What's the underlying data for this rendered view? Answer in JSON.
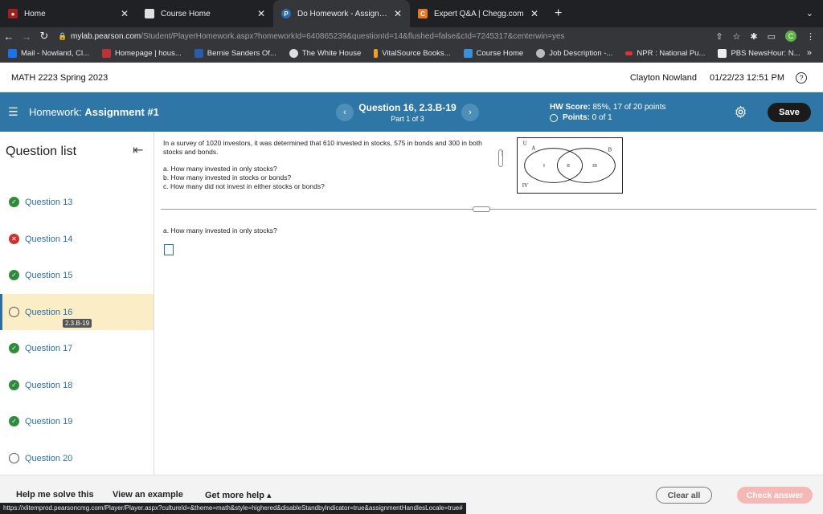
{
  "browser": {
    "tabs": [
      {
        "label": "Home",
        "favicon_color": "#a31f1f",
        "active": false
      },
      {
        "label": "Course Home",
        "favicon_color": "#e0e0e0",
        "active": false
      },
      {
        "label": "Do Homework - Assignment #1",
        "favicon_color": "#2b6cb0",
        "active": true
      },
      {
        "label": "Expert Q&A | Chegg.com",
        "favicon_color": "#e87722",
        "active": false
      }
    ],
    "new_tab": "+",
    "url_host": "mylab.pearson.com",
    "url_path": "/Student/PlayerHomework.aspx?homeworkId=640865239&questionId=14&flushed=false&cId=7245317&centerwin=yes",
    "profile_initial": "C",
    "bookmarks": [
      {
        "label": "Mail - Nowland, Cl...",
        "color": "#1a73e8"
      },
      {
        "label": "Homepage | hous...",
        "color": "#b33"
      },
      {
        "label": "Bernie Sanders Of...",
        "color": "#2a5caa"
      },
      {
        "label": "The White House",
        "color": "#ddd"
      },
      {
        "label": "VitalSource Books...",
        "color": "#f0a020"
      },
      {
        "label": "Course Home",
        "color": "#3a8fd6"
      },
      {
        "label": "Job Description -...",
        "color": "#bbb"
      },
      {
        "label": "NPR : National Pu...",
        "color": "#d33"
      },
      {
        "label": "PBS NewsHour: N...",
        "color": "#eee"
      }
    ],
    "bookmarks_more": "»",
    "status_url": "https://xlitemprod.pearsoncmg.com/Player/Player.aspx?cultureId=&theme=math&style=highered&disableStandbyIndicator=true&assignmentHandlesLocale=true#"
  },
  "course": {
    "name": "MATH 2223 Spring 2023",
    "user": "Clayton Nowland",
    "datetime": "01/22/23 12:51 PM"
  },
  "homework": {
    "title_prefix": "Homework:",
    "title_name": "Assignment #1",
    "question_title": "Question 16, 2.3.B-19",
    "part": "Part 1 of 3",
    "score_label": "HW Score:",
    "score_value": "85%, 17 of 20 points",
    "points_label": "Points:",
    "points_value": "0 of 1",
    "save_label": "Save",
    "accent": "#2d76a6"
  },
  "sidebar": {
    "heading": "Question list",
    "items": [
      {
        "label": "Question 13",
        "status": "ok"
      },
      {
        "label": "Question 14",
        "status": "bad"
      },
      {
        "label": "Question 15",
        "status": "ok"
      },
      {
        "label": "Question 16",
        "status": "open",
        "tag": "2.3.B-19"
      },
      {
        "label": "Question 17",
        "status": "ok"
      },
      {
        "label": "Question 18",
        "status": "ok"
      },
      {
        "label": "Question 19",
        "status": "ok"
      },
      {
        "label": "Question 20",
        "status": "open"
      }
    ]
  },
  "problem": {
    "text": "In a survey of 1020 investors, it was determined that 610 invested in stocks, 575 in bonds and 300 in both stocks and bonds.",
    "part_a": "a. How many invested in only stocks?",
    "part_b": "b. How many invested in stocks or bonds?",
    "part_c": "c. How many did not invest in either stocks or bonds?",
    "venn": {
      "universe": "U",
      "set_a": "A",
      "set_b": "B",
      "r1": "I",
      "r2": "II",
      "r3": "III",
      "r4": "IV"
    },
    "current_question": "a. How many invested in only stocks?"
  },
  "footer": {
    "help_solve": "Help me solve this",
    "example": "View an example",
    "more_help": "Get more help ▴",
    "clear_all": "Clear all",
    "check_answer": "Check answer"
  }
}
